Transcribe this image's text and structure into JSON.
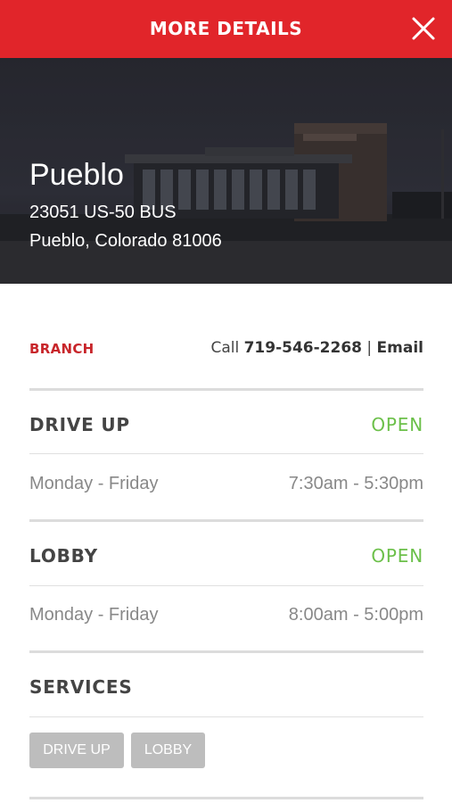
{
  "header": {
    "title": "MORE DETAILS",
    "close_icon": "close-icon",
    "background_color": "#e1252a"
  },
  "location": {
    "name": "Pueblo",
    "address_line1": "23051 US-50 BUS",
    "address_line2": "Pueblo, Colorado 81006"
  },
  "contact": {
    "type_label": "BRANCH",
    "call_prefix": "Call",
    "phone": "719-546-2268",
    "separator": "|",
    "email_label": "Email"
  },
  "drive_up": {
    "title": "DRIVE UP",
    "status": "OPEN",
    "days": "Monday - Friday",
    "hours": "7:30am - 5:30pm"
  },
  "lobby": {
    "title": "LOBBY",
    "status": "OPEN",
    "days": "Monday - Friday",
    "hours": "8:00am - 5:00pm"
  },
  "services": {
    "title": "SERVICES",
    "items": [
      "DRIVE UP",
      "LOBBY"
    ]
  },
  "colors": {
    "accent_red": "#e1252a",
    "open_green": "#6cc04a",
    "chip_gray": "#bdbdbd"
  }
}
